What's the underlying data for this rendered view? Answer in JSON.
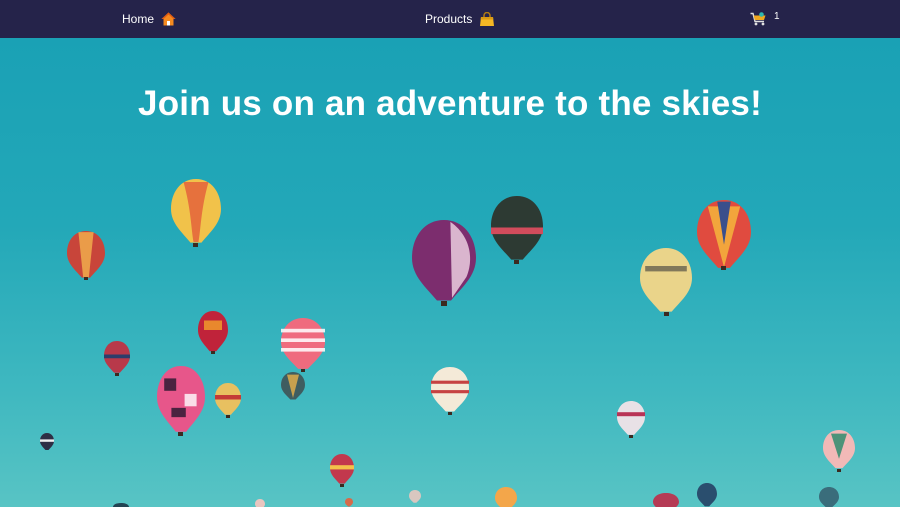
{
  "nav": {
    "home_label": "Home",
    "products_label": "Products",
    "cart_count": "1",
    "icons": [
      "home-icon",
      "shopping-bag-icon",
      "shopping-cart-icon"
    ],
    "background_color": "#25234a"
  },
  "hero": {
    "title": "Join us on an adventure to the skies!",
    "sky_color": "#1aa1b5"
  }
}
